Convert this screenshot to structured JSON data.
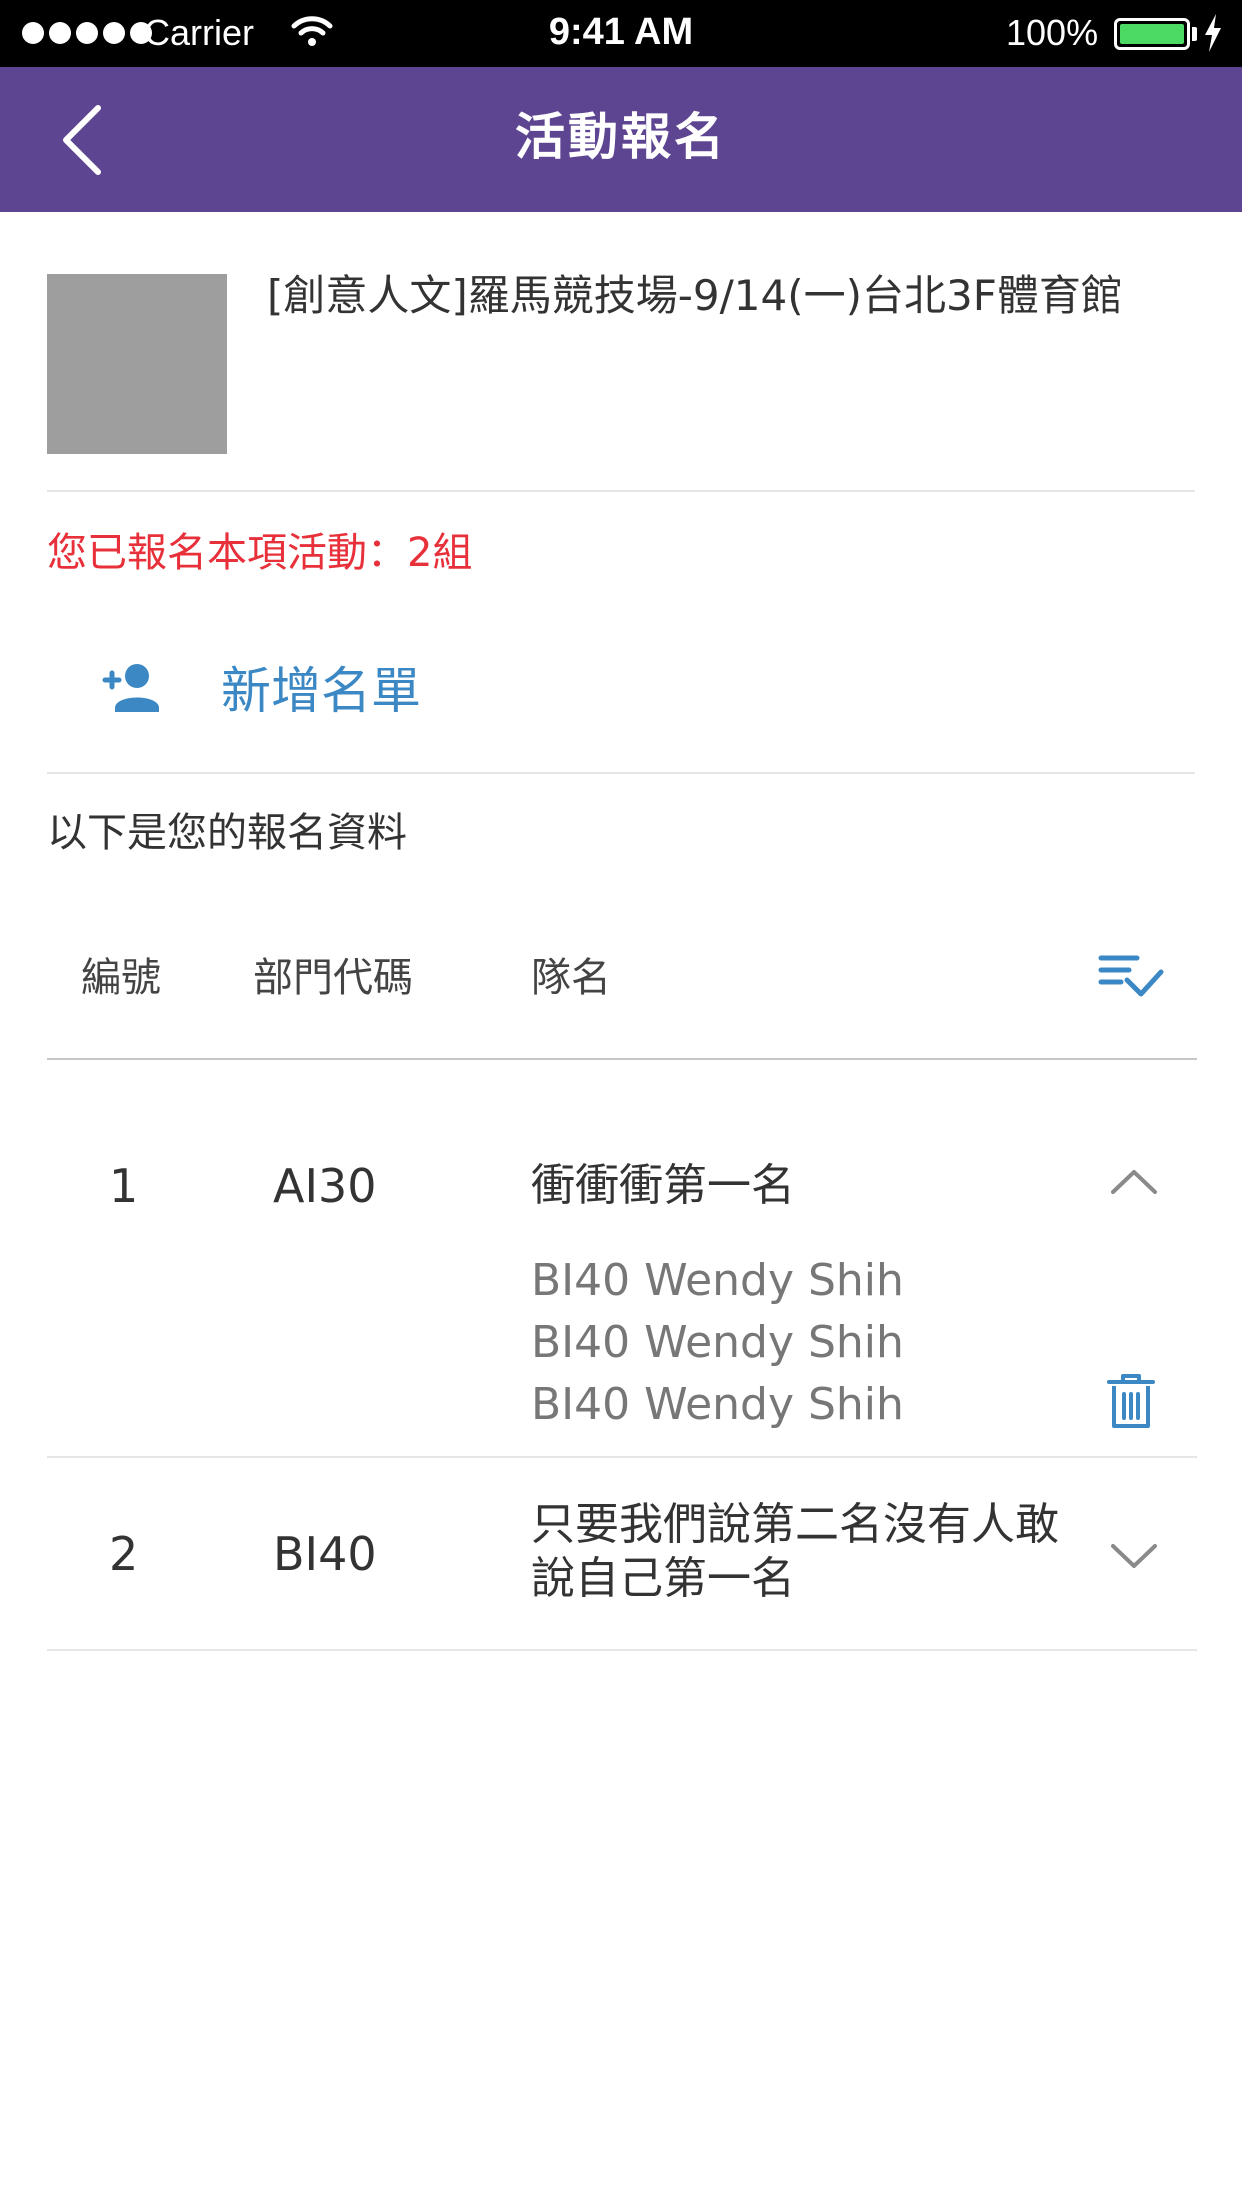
{
  "status_bar": {
    "carrier": "Carrier",
    "time": "9:41 AM",
    "battery": "100%",
    "icons": [
      "signal-dots-icon",
      "wifi-icon",
      "battery-icon",
      "charging-bolt-icon"
    ]
  },
  "nav": {
    "title": "活動報名",
    "back_icon": "chevron-left-icon"
  },
  "event": {
    "name": "[創意人文]羅馬競技場-9/14(一)台北3F體育館"
  },
  "registered_text": "您已報名本項活動：2組",
  "add_list": {
    "label": "新增名單",
    "icon": "add-person-icon"
  },
  "info_label": "以下是您的報名資料",
  "table": {
    "headers": {
      "no": "編號",
      "dept": "部門代碼",
      "team": "隊名"
    },
    "sort_icon": "sort-check-icon",
    "rows": [
      {
        "no": "1",
        "dept": "AI30",
        "team": "衝衝衝第一名",
        "expanded": true,
        "members": [
          "BI40 Wendy Shih",
          "BI40 Wendy Shih",
          "BI40 Wendy Shih"
        ]
      },
      {
        "no": "2",
        "dept": "BI40",
        "team": "只要我們說第二名沒有人敢說自己第一名",
        "expanded": false
      }
    ]
  },
  "colors": {
    "nav_bg": "#5d4591",
    "accent_blue": "#3b88c4",
    "alert_red": "#e8303a",
    "thumb_gray": "#9e9e9e"
  }
}
